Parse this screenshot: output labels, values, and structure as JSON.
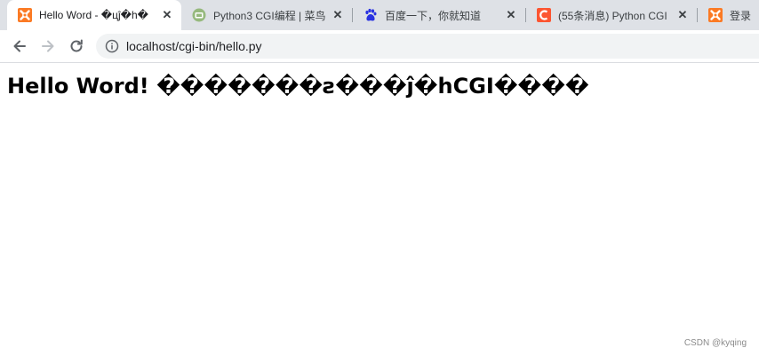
{
  "tabs": [
    {
      "title": "Hello Word - �цĵ�h�",
      "icon": "xampp-icon",
      "active": true
    },
    {
      "title": "Python3 CGI编程 | 菜鸟",
      "icon": "runoob-icon",
      "active": false
    },
    {
      "title": "百度一下，你就知道",
      "icon": "baidu-icon",
      "active": false
    },
    {
      "title": "(55条消息) Python CGI",
      "icon": "csdn-icon",
      "active": false
    },
    {
      "title": "登录",
      "icon": "xampp-icon",
      "active": false
    }
  ],
  "tab_close_glyph": "✕",
  "address_bar": {
    "url": "localhost/cgi-bin/hello.py"
  },
  "page": {
    "heading": "Hello Word! �������ƨ���ĵ�hCGI����"
  },
  "watermark": "CSDN @kyqing",
  "colors": {
    "tabstrip": "#dee1e6",
    "xampp": "#fb7a24",
    "runoob": "#96b97d",
    "baidu": "#2932e1",
    "csdn": "#fc5531"
  }
}
